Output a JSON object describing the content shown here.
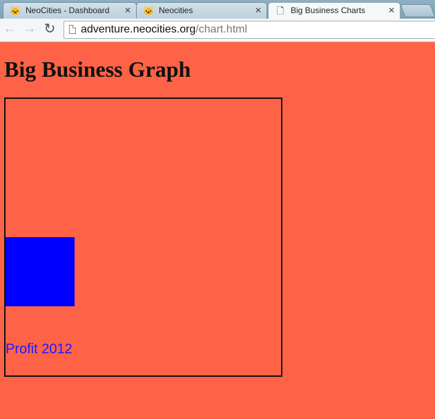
{
  "browser": {
    "tabs": [
      {
        "title": "NeoCities - Dashboard",
        "icon": "cat-icon",
        "active": false
      },
      {
        "title": "Neocities",
        "icon": "cat-icon",
        "active": false
      },
      {
        "title": "Big Business Charts",
        "icon": "page-icon",
        "active": true
      }
    ],
    "url_host": "adventure.neocities.org",
    "url_path": "/chart.html"
  },
  "page": {
    "heading": "Big Business Graph",
    "background": "#ff6347"
  },
  "chart_data": {
    "type": "bar",
    "categories": [
      "Profit 2012"
    ],
    "values": [
      1
    ],
    "bar_color": "#0000ff"
  }
}
